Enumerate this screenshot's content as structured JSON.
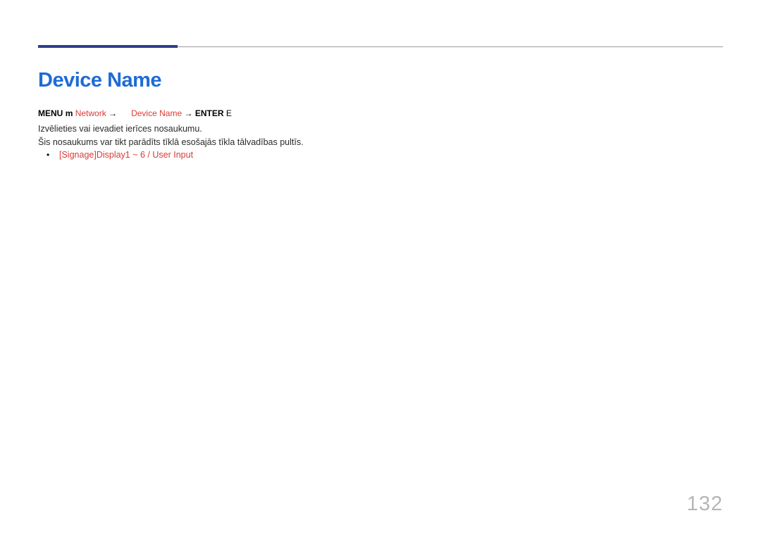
{
  "heading": "Device Name",
  "breadcrumb": {
    "menu_label": "MENU",
    "menu_symbol": "m",
    "network_label": "Network",
    "device_name_label": "Device Name",
    "enter_label": "ENTER",
    "enter_symbol": "E",
    "arrow": "→"
  },
  "body_line_1": "Izvēlieties vai ievadiet ierīces nosaukumu.",
  "body_line_2": "Šis nosaukums var tikt parādīts tīklā esošajās tīkla tālvadības pultīs.",
  "bullet_item": "[Signage]Display1 ~ 6 / User Input",
  "page_number": "132"
}
